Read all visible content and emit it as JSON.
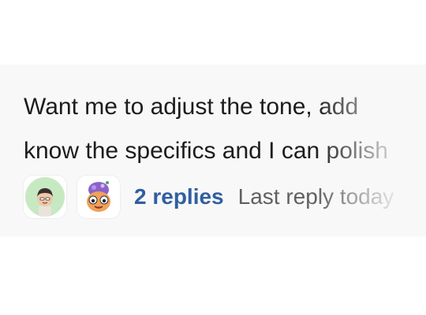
{
  "message": {
    "line1": "Want me to adjust the tone, add",
    "line2": "know the specifics and I can polish"
  },
  "thread": {
    "avatars": [
      {
        "icon": "user-avatar-icon",
        "bg": "#c7e9c2"
      },
      {
        "icon": "bot-avatar-icon",
        "bg": "#ffffff"
      }
    ],
    "replies_label": "2 replies",
    "last_reply_label": "Last reply today"
  },
  "colors": {
    "link": "#2f5fa0",
    "text": "#1d1c1d",
    "muted": "#616061",
    "card_bg": "#f8f8f8"
  }
}
